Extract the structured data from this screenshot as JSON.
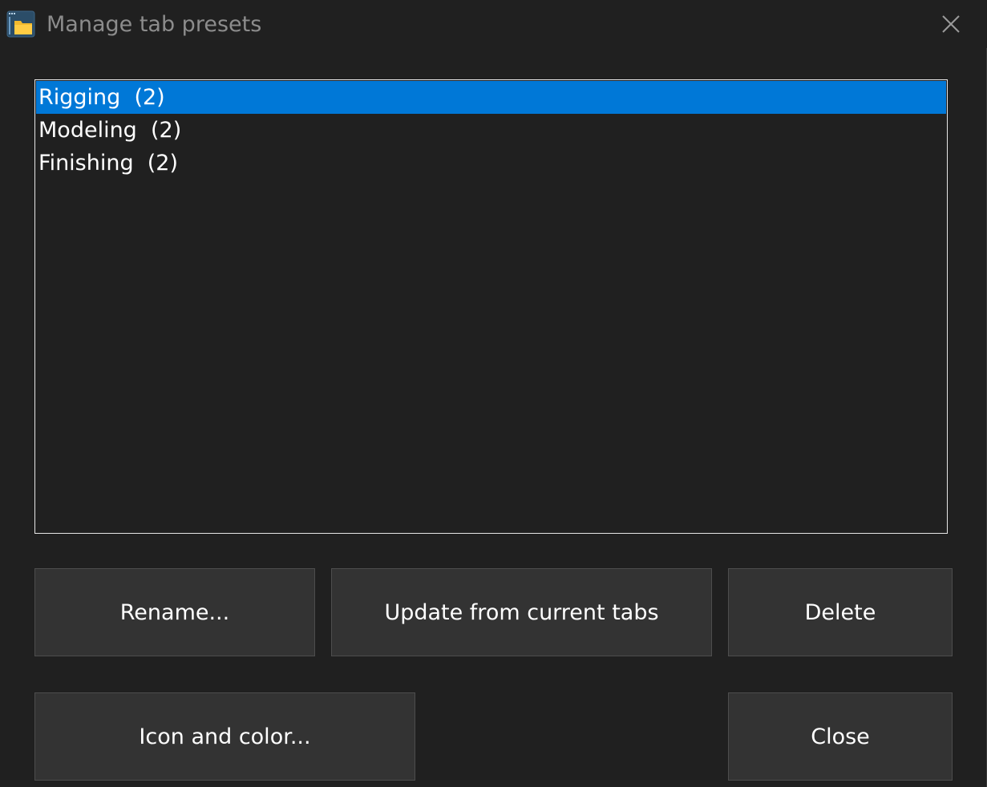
{
  "window": {
    "title": "Manage tab presets",
    "app_icon": "folder-app-icon",
    "close_icon": "close-icon"
  },
  "presets": {
    "items": [
      {
        "label": "Rigging  (2)",
        "selected": true
      },
      {
        "label": "Modeling  (2)",
        "selected": false
      },
      {
        "label": "Finishing  (2)",
        "selected": false
      }
    ]
  },
  "buttons": {
    "rename": "Rename...",
    "update": "Update from current tabs",
    "delete": "Delete",
    "icon_color": "Icon and color...",
    "close": "Close"
  },
  "colors": {
    "background": "#202020",
    "selection": "#0078d7",
    "button": "#333333",
    "title_text": "#8c8c8c"
  }
}
